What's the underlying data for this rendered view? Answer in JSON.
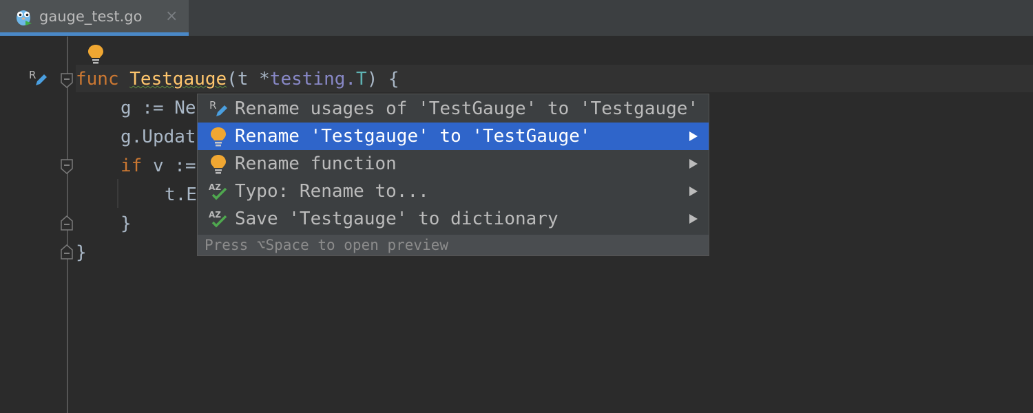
{
  "tab": {
    "title": "gauge_test.go",
    "close": "×"
  },
  "code": {
    "line1": {
      "kw": "func",
      "name": "Testgauge",
      "rest1": "(t *",
      "type": "testing.",
      "T": "T",
      "rest2": ") {"
    },
    "line2": {
      "text": "g := Ne"
    },
    "line3": {
      "text": "g.Updat"
    },
    "line4": {
      "kw": "if",
      "rest": " v :="
    },
    "line5": {
      "text": "t.E"
    },
    "line6": {
      "text": "}"
    },
    "line7": {
      "text": "}"
    }
  },
  "popup": {
    "items": [
      {
        "label": "Rename usages of 'TestGauge' to 'Testgauge'",
        "icon": "rename-refactor-icon",
        "submenu": false,
        "selected": false
      },
      {
        "label": "Rename 'Testgauge' to 'TestGauge'",
        "icon": "lightbulb-icon",
        "submenu": true,
        "selected": true
      },
      {
        "label": "Rename function",
        "icon": "lightbulb-icon",
        "submenu": true,
        "selected": false
      },
      {
        "label": "Typo: Rename to...",
        "icon": "spellcheck-icon",
        "submenu": true,
        "selected": false
      },
      {
        "label": "Save 'Testgauge' to dictionary",
        "icon": "spellcheck-icon",
        "submenu": true,
        "selected": false
      }
    ],
    "footer": "Press ⌥Space to open preview"
  },
  "colors": {
    "accent": "#2f65ca",
    "bulb": "#f0a732",
    "check": "#4fa84f",
    "editor_bg": "#2b2b2b"
  }
}
